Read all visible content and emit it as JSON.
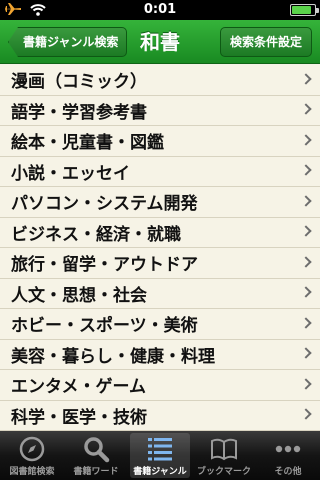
{
  "status_bar": {
    "time": "0:01",
    "battery_level": 0.85
  },
  "nav": {
    "back_label": "書籍ジャンル検索",
    "title": "和書",
    "right_label": "検索条件設定"
  },
  "genres": [
    "漫画（コミック）",
    "語学・学習参考書",
    "絵本・児童書・図鑑",
    "小説・エッセイ",
    "パソコン・システム開発",
    "ビジネス・経済・就職",
    "旅行・留学・アウトドア",
    "人文・思想・社会",
    "ホビー・スポーツ・美術",
    "美容・暮らし・健康・料理",
    "エンタメ・ゲーム",
    "科学・医学・技術"
  ],
  "tabs": [
    {
      "label": "図書館検索",
      "icon": "compass-icon"
    },
    {
      "label": "書籍ワード",
      "icon": "magnifier-icon"
    },
    {
      "label": "書籍ジャンル",
      "icon": "list-icon",
      "selected": true
    },
    {
      "label": "ブックマーク",
      "icon": "book-icon"
    },
    {
      "label": "その他",
      "icon": "more-icon"
    }
  ],
  "colors": {
    "nav": "#198a22",
    "list_bg": "#f6f3e6",
    "tabbar": "#0a0a0a"
  }
}
